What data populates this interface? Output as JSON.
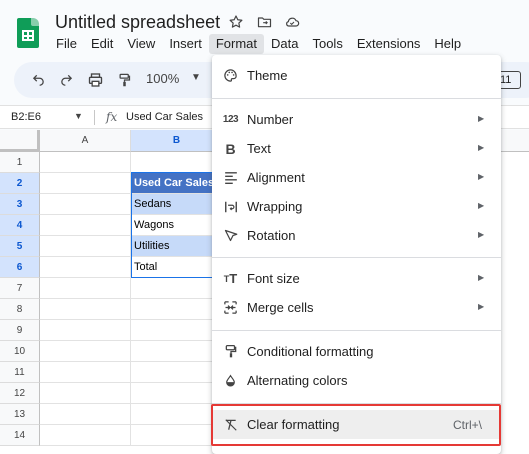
{
  "app": {
    "title": "Untitled spreadsheet",
    "accent_color": "#0f9d58"
  },
  "title_icons": [
    "star-icon",
    "move-folder-icon",
    "cloud-status-icon"
  ],
  "menubar": [
    {
      "label": "File"
    },
    {
      "label": "Edit"
    },
    {
      "label": "View"
    },
    {
      "label": "Insert"
    },
    {
      "label": "Format",
      "active": true
    },
    {
      "label": "Data"
    },
    {
      "label": "Tools"
    },
    {
      "label": "Extensions"
    },
    {
      "label": "Help"
    }
  ],
  "toolbar": {
    "icons": [
      "undo-icon",
      "redo-icon",
      "print-icon",
      "paint-format-icon"
    ],
    "zoom": "100%",
    "right_partial": "11"
  },
  "formula_bar": {
    "name_box": "B2:E6",
    "fx": "fx",
    "content": "Used Car Sales"
  },
  "grid": {
    "columns": [
      "A",
      "B"
    ],
    "selected_column": "B",
    "rows": [
      "1",
      "2",
      "3",
      "4",
      "5",
      "6",
      "7",
      "8",
      "9",
      "10",
      "11",
      "12",
      "13",
      "14"
    ],
    "selected_rows": [
      "2",
      "3",
      "4",
      "5",
      "6"
    ],
    "cells_b": [
      "Used Car Sales",
      "Sedans",
      "Wagons",
      "Utilities",
      "Total"
    ],
    "header_color": "#4472c4",
    "selection_color": "#c6daf9"
  },
  "format_menu": {
    "items": [
      {
        "label": "Theme",
        "icon": "palette-icon",
        "submenu": false
      },
      {
        "label": "Number",
        "icon": "number-format-icon",
        "submenu": true
      },
      {
        "label": "Text",
        "icon": "bold-icon",
        "submenu": true
      },
      {
        "label": "Alignment",
        "icon": "align-left-icon",
        "submenu": true
      },
      {
        "label": "Wrapping",
        "icon": "text-wrap-icon",
        "submenu": true
      },
      {
        "label": "Rotation",
        "icon": "text-rotation-icon",
        "submenu": true
      },
      {
        "label": "Font size",
        "icon": "font-size-icon",
        "submenu": true
      },
      {
        "label": "Merge cells",
        "icon": "merge-cells-icon",
        "submenu": true
      },
      {
        "label": "Conditional formatting",
        "icon": "paint-roller-icon",
        "submenu": false
      },
      {
        "label": "Alternating colors",
        "icon": "color-drop-icon",
        "submenu": false
      },
      {
        "label": "Clear formatting",
        "icon": "clear-formatting-icon",
        "submenu": false,
        "shortcut": "Ctrl+\\",
        "highlighted": true
      }
    ],
    "highlight_color": "#e53935"
  }
}
